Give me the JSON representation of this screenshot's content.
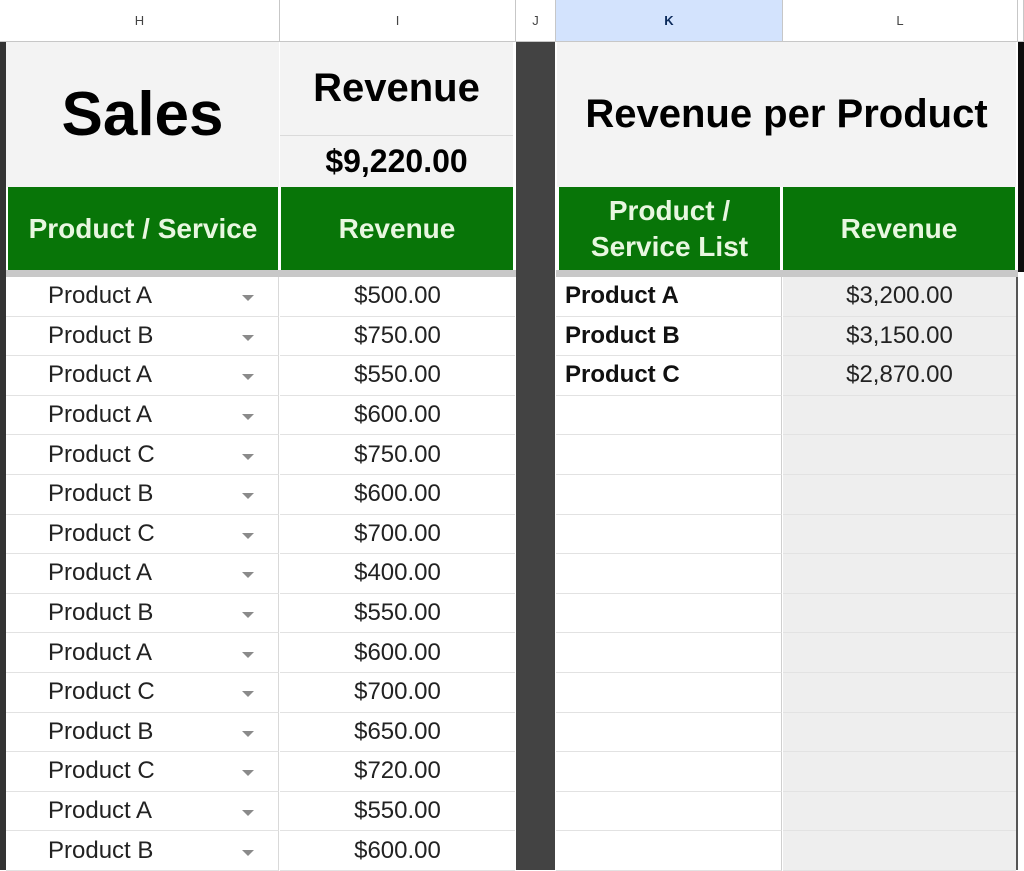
{
  "column_headers": [
    {
      "letter": "H",
      "selected": false
    },
    {
      "letter": "I",
      "selected": false
    },
    {
      "letter": "J",
      "selected": false
    },
    {
      "letter": "K",
      "selected": true
    },
    {
      "letter": "L",
      "selected": false
    }
  ],
  "sales_table": {
    "title": "Sales",
    "revenue_label": "Revenue",
    "total_revenue": "$9,220.00",
    "headers": [
      "Product / Service",
      "Revenue"
    ],
    "rows": [
      {
        "product": "Product A",
        "revenue": "$500.00"
      },
      {
        "product": "Product B",
        "revenue": "$750.00"
      },
      {
        "product": "Product A",
        "revenue": "$550.00"
      },
      {
        "product": "Product A",
        "revenue": "$600.00"
      },
      {
        "product": "Product C",
        "revenue": "$750.00"
      },
      {
        "product": "Product B",
        "revenue": "$600.00"
      },
      {
        "product": "Product C",
        "revenue": "$700.00"
      },
      {
        "product": "Product A",
        "revenue": "$400.00"
      },
      {
        "product": "Product B",
        "revenue": "$550.00"
      },
      {
        "product": "Product A",
        "revenue": "$600.00"
      },
      {
        "product": "Product C",
        "revenue": "$700.00"
      },
      {
        "product": "Product B",
        "revenue": "$650.00"
      },
      {
        "product": "Product C",
        "revenue": "$720.00"
      },
      {
        "product": "Product A",
        "revenue": "$550.00"
      },
      {
        "product": "Product B",
        "revenue": "$600.00"
      }
    ]
  },
  "summary_table": {
    "title": "Revenue per Product",
    "headers": [
      "Product / Service List",
      "Revenue"
    ],
    "rows": [
      {
        "product": "Product A",
        "revenue": "$3,200.00"
      },
      {
        "product": "Product B",
        "revenue": "$3,150.00"
      },
      {
        "product": "Product C",
        "revenue": "$2,870.00"
      },
      {
        "product": "",
        "revenue": ""
      },
      {
        "product": "",
        "revenue": ""
      },
      {
        "product": "",
        "revenue": ""
      },
      {
        "product": "",
        "revenue": ""
      },
      {
        "product": "",
        "revenue": ""
      },
      {
        "product": "",
        "revenue": ""
      },
      {
        "product": "",
        "revenue": ""
      },
      {
        "product": "",
        "revenue": ""
      },
      {
        "product": "",
        "revenue": ""
      },
      {
        "product": "",
        "revenue": ""
      },
      {
        "product": "",
        "revenue": ""
      },
      {
        "product": "",
        "revenue": ""
      }
    ]
  },
  "colors": {
    "header_green": "#087508",
    "header_text": "#e8f7e0",
    "selected_column": "#d3e3fd",
    "divider_column": "#434343"
  }
}
